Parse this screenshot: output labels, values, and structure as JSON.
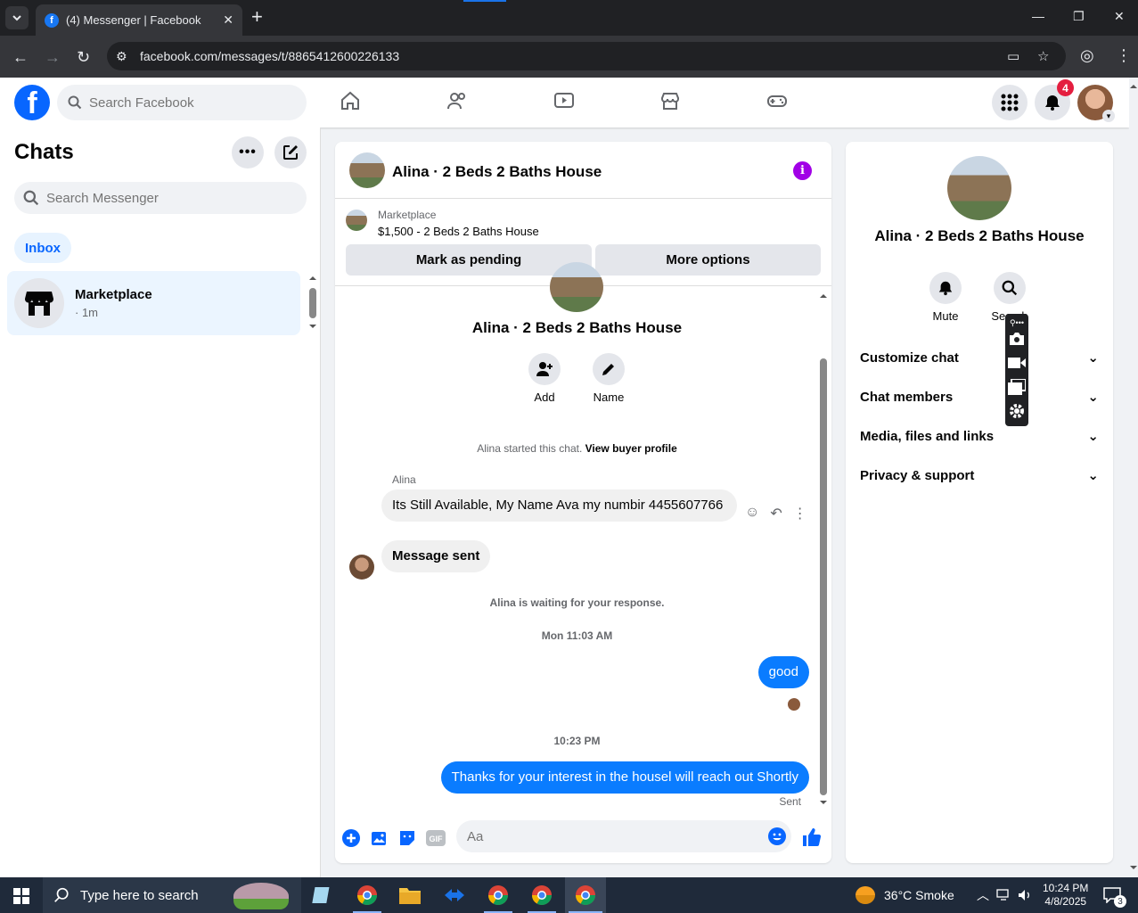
{
  "browser": {
    "tab_title": "(4) Messenger | Facebook",
    "url": "facebook.com/messages/t/8865412600226133"
  },
  "fb": {
    "search_placeholder": "Search Facebook",
    "notif_count": "4"
  },
  "left": {
    "title": "Chats",
    "search_placeholder": "Search Messenger",
    "filter": "Inbox",
    "chats": [
      {
        "name": "Marketplace",
        "time": "· 1m"
      }
    ]
  },
  "convo": {
    "title": "Alina · 2 Beds 2 Baths House",
    "marketplace_label": "Marketplace",
    "listing": "$1,500 - 2 Beds 2 Baths House",
    "mark_pending": "Mark as pending",
    "more_options": "More options",
    "profile_name": "Alina · 2 Beds 2 Baths House",
    "add_label": "Add",
    "name_label": "Name",
    "started_text": "Alina started this chat.",
    "view_buyer": "View buyer profile",
    "sender_name": "Alina",
    "msg1": "Its Still Available, My Name Ava my numbir 4455607766",
    "msg2": "Message sent",
    "waiting": "Alina is waiting for your response.",
    "time1": "Mon 11:03 AM",
    "out1": "good",
    "time2": "10:23 PM",
    "out2": "Thanks for your interest in the housel will reach out Shortly",
    "sent_status": "Sent",
    "composer_placeholder": "Aa"
  },
  "right": {
    "name": "Alina · 2 Beds 2 Baths House",
    "mute": "Mute",
    "search": "Search",
    "items": [
      "Customize chat",
      "Chat members",
      "Media, files and links",
      "Privacy & support"
    ]
  },
  "taskbar": {
    "search_placeholder": "Type here to search",
    "weather": "36°C  Smoke",
    "time": "10:24 PM",
    "date": "4/8/2025",
    "notif": "3"
  },
  "colors": {
    "fb_blue": "#0866ff",
    "messenger_blue": "#0a7cff",
    "notif_red": "#e41e3f",
    "info_purple": "#a100e6"
  }
}
